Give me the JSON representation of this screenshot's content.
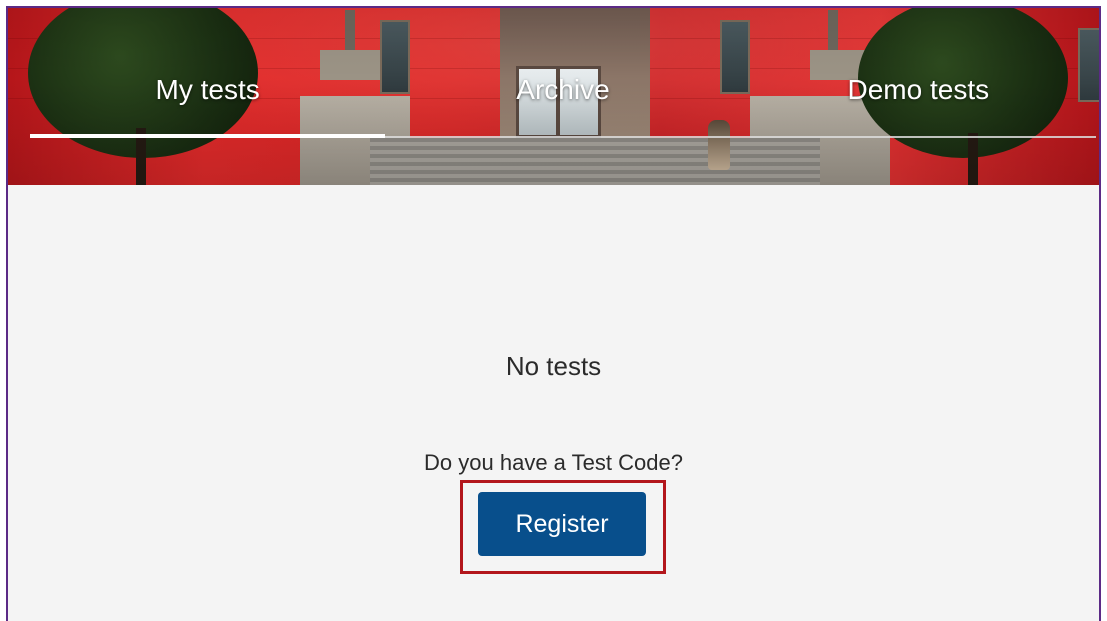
{
  "tabs": [
    {
      "label": "My tests",
      "active": true
    },
    {
      "label": "Archive",
      "active": false
    },
    {
      "label": "Demo tests",
      "active": false
    }
  ],
  "empty_state": {
    "title": "No tests",
    "prompt": "Do you have a Test Code?",
    "register_label": "Register"
  },
  "colors": {
    "frame_border": "#5b2a86",
    "button": "#084f8c",
    "highlight": "#b3161c",
    "background": "#f4f4f4"
  }
}
